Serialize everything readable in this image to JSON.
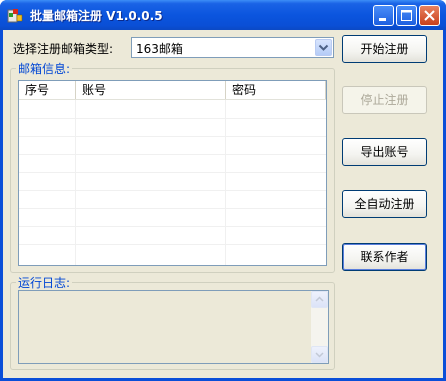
{
  "window": {
    "title": "批量邮箱注册 V1.0.0.5",
    "titlebar_color": "#0a4ed8",
    "client_bg": "#ece9d8"
  },
  "form": {
    "type_label": "选择注册邮箱类型:",
    "type_selected": "163邮箱"
  },
  "mailbox_group": {
    "title": "邮箱信息:",
    "columns": [
      "序号",
      "账号",
      "密码"
    ],
    "rows": []
  },
  "log_group": {
    "title": "运行日志:",
    "content": ""
  },
  "buttons": {
    "start": "开始注册",
    "stop": "停止注册",
    "export": "导出账号",
    "auto": "全自动注册",
    "contact": "联系作者"
  },
  "icons": {
    "app": "app-icon",
    "minimize": "minimize-icon",
    "maximize": "maximize-icon",
    "close": "close-icon",
    "dropdown": "chevron-down-icon"
  },
  "colors": {
    "group_title": "#0046d5",
    "disabled_text": "#aca899"
  }
}
